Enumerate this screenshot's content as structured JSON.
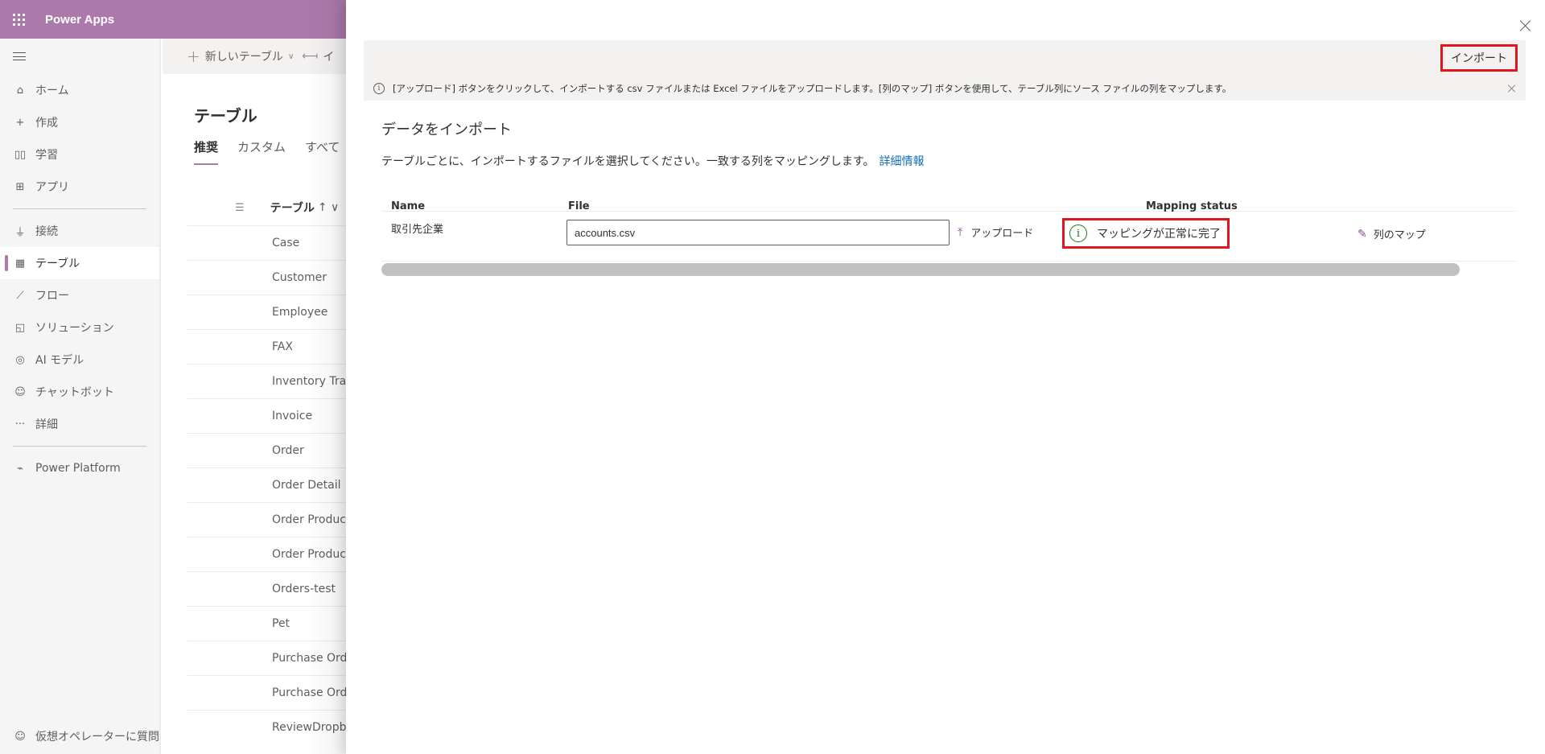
{
  "topbar": {
    "app_name": "Power Apps",
    "waffle_icon": "waffle-icon"
  },
  "sidebar": {
    "items": [
      {
        "label": "ホーム",
        "icon": "⌂",
        "icon_name": "home-icon",
        "active": false
      },
      {
        "label": "作成",
        "icon": "+",
        "icon_name": "plus-icon",
        "active": false
      },
      {
        "label": "学習",
        "icon": "▯▯",
        "icon_name": "book-icon",
        "active": false
      },
      {
        "label": "アプリ",
        "icon": "⊞",
        "icon_name": "apps-icon",
        "active": false
      },
      {
        "label": "接続",
        "icon": "⏚",
        "icon_name": "plug-icon",
        "active": false
      },
      {
        "label": "テーブル",
        "icon": "▦",
        "icon_name": "table-icon",
        "active": true
      },
      {
        "label": "フロー",
        "icon": "⟋",
        "icon_name": "flow-icon",
        "active": false
      },
      {
        "label": "ソリューション",
        "icon": "◱",
        "icon_name": "solution-icon",
        "active": false
      },
      {
        "label": "AI モデル",
        "icon": "◎",
        "icon_name": "ai-brain-icon",
        "active": false
      },
      {
        "label": "チャットボット",
        "icon": "☺",
        "icon_name": "chatbot-icon",
        "active": false
      },
      {
        "label": "詳細",
        "icon": "···",
        "icon_name": "more-icon",
        "active": false
      },
      {
        "label": "Power Platform",
        "icon": "⌁",
        "icon_name": "power-platform-icon",
        "active": false
      }
    ],
    "bottom": {
      "label": "仮想オペレーターに質問",
      "icon": "☺"
    }
  },
  "background": {
    "command_bar": {
      "new_table": "新しいテーブル",
      "import": "イ"
    },
    "page_title": "テーブル",
    "tabs": [
      {
        "label": "推奨",
        "active": true
      },
      {
        "label": "カスタム",
        "active": false
      },
      {
        "label": "すべて",
        "active": false
      }
    ],
    "list_header": {
      "column": "テーブル",
      "sort": "↑ ∨"
    },
    "rows": [
      "Case",
      "Customer",
      "Employee",
      "FAX",
      "Inventory Trans",
      "Invoice",
      "Order",
      "Order Detail",
      "Order Product",
      "Order Product",
      "Orders-test",
      "Pet",
      "Purchase Orde",
      "Purchase Orde",
      "ReviewDropbo"
    ]
  },
  "panel": {
    "import_button": "インポート",
    "info_text": "[アップロード] ボタンをクリックして、インポートする csv ファイルまたは Excel ファイルをアップロードします。[列のマップ] ボタンを使用して、テーブル列にソース ファイルの列をマップします。",
    "title": "データをインポート",
    "description": "テーブルごとに、インポートするファイルを選択してください。一致する列をマッピングします。",
    "learn_more": "詳細情報",
    "grid": {
      "headers": {
        "name": "Name",
        "file": "File",
        "status": "Mapping status"
      },
      "rows": [
        {
          "name": "取引先企業",
          "file": "accounts.csv",
          "upload_label": "アップロード",
          "status": "マッピングが正常に完了",
          "map_label": "列のマップ"
        }
      ]
    }
  },
  "colors": {
    "brand": "#ab7aab",
    "highlight": "#e0161e",
    "success": "#107c10",
    "link": "#0f6cbd"
  }
}
